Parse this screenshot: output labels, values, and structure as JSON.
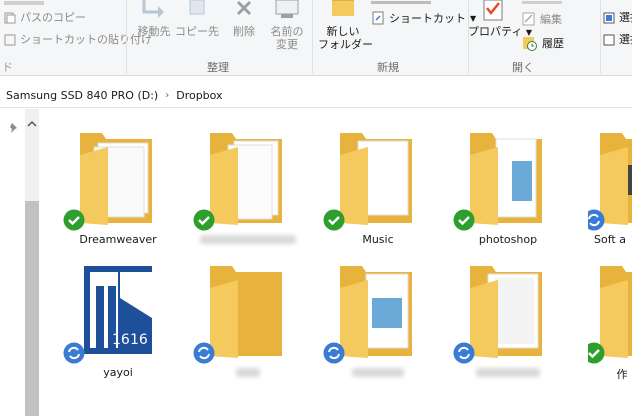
{
  "ribbon": {
    "clipboard": {
      "copy_path": "パスのコピー",
      "paste_shortcut": "ショートカットの貼り付け"
    },
    "organize": {
      "label": "整理",
      "move_to": "移動先",
      "copy_to": "コピー先",
      "delete": "削除",
      "rename_l1": "名前の",
      "rename_l2": "変更"
    },
    "new": {
      "label": "新規",
      "new_folder_l1": "新しい",
      "new_folder_l2": "フォルダー",
      "shortcut": "ショートカット"
    },
    "open": {
      "label": "開く",
      "properties": "プロパティ",
      "edit": "編集",
      "history": "履歴"
    },
    "select": {
      "select1": "選択",
      "select2": "選択"
    }
  },
  "address": {
    "drive": "Samsung SSD 840 PRO (D:)",
    "folder": "Dropbox"
  },
  "items": [
    {
      "label": "Dreamweaver",
      "status": "synced"
    },
    {
      "label": "",
      "status": "synced"
    },
    {
      "label": "Music",
      "status": "synced"
    },
    {
      "label": "photoshop",
      "status": "synced"
    },
    {
      "label": "Soft a",
      "status": "syncing"
    },
    {
      "label": "yayoi",
      "status": "syncing"
    },
    {
      "label": "",
      "status": "syncing"
    },
    {
      "label": "",
      "status": "syncing"
    },
    {
      "label": "",
      "status": "syncing"
    },
    {
      "label": "作",
      "status": "synced"
    }
  ],
  "colors": {
    "synced": "#2e9e2e",
    "syncing": "#3a7bd5",
    "folder": "#f4c95d"
  }
}
